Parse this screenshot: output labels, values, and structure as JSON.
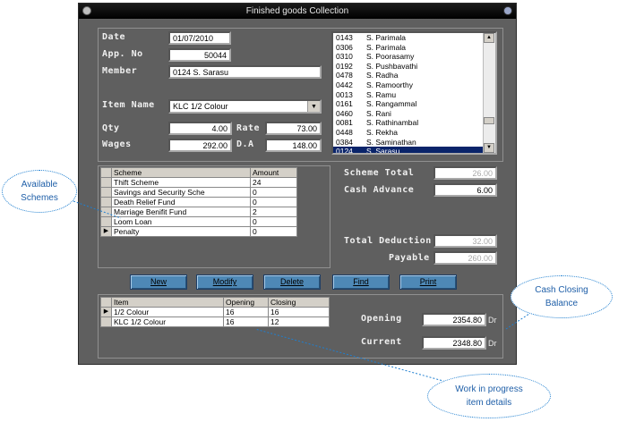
{
  "window": {
    "title": "Finished goods Collection"
  },
  "form": {
    "date_label": "Date",
    "date_value": "01/07/2010",
    "app_no_label": "App. No",
    "app_no_value": "50044",
    "member_label": "Member",
    "member_value": "0124   S. Sarasu",
    "item_name_label": "Item Name",
    "item_name_value": "KLC 1/2 Colour",
    "qty_label": "Qty",
    "qty_value": "4.00",
    "rate_label": "Rate",
    "rate_value": "73.00",
    "wages_label": "Wages",
    "wages_value": "292.00",
    "da_label": "D.A",
    "da_value": "148.00"
  },
  "members": [
    {
      "code": "0143",
      "name": "S. Parimala"
    },
    {
      "code": "0306",
      "name": "S. Parimala"
    },
    {
      "code": "0310",
      "name": "S. Poorasamy"
    },
    {
      "code": "0192",
      "name": "S. Pushbavathi"
    },
    {
      "code": "0478",
      "name": "S. Radha"
    },
    {
      "code": "0442",
      "name": "S. Ramoorthy"
    },
    {
      "code": "0013",
      "name": "S. Ramu"
    },
    {
      "code": "0161",
      "name": "S. Rangammal"
    },
    {
      "code": "0460",
      "name": "S. Rani"
    },
    {
      "code": "0081",
      "name": "S. Rathinambal"
    },
    {
      "code": "0448",
      "name": "S. Rekha"
    },
    {
      "code": "0384",
      "name": "S. Saminathan"
    },
    {
      "code": "0124",
      "name": "S. Sarasu"
    }
  ],
  "schemes": {
    "headers": [
      "Scheme",
      "Amount"
    ],
    "rows": [
      {
        "scheme": "Thift Scheme",
        "amount": "24"
      },
      {
        "scheme": "Savings and Security Sche",
        "amount": "0"
      },
      {
        "scheme": "Death Relief Fund",
        "amount": "0"
      },
      {
        "scheme": "Marriage Benifit Fund",
        "amount": "2"
      },
      {
        "scheme": "Loom Loan",
        "amount": "0"
      },
      {
        "scheme": "Penalty",
        "amount": "0"
      }
    ]
  },
  "totals": {
    "scheme_total_label": "Scheme Total",
    "scheme_total_value": "26.00",
    "cash_advance_label": "Cash Advance",
    "cash_advance_value": "6.00",
    "total_deduction_label": "Total Deduction",
    "total_deduction_value": "32.00",
    "payable_label": "Payable",
    "payable_value": "260.00"
  },
  "buttons": {
    "new": "New",
    "modify": "Modify",
    "delete": "Delete",
    "find": "Find",
    "print": "Print"
  },
  "items": {
    "headers": [
      "Item",
      "Opening",
      "Closing"
    ],
    "rows": [
      {
        "item": "1/2 Colour",
        "opening": "16",
        "closing": "16"
      },
      {
        "item": "KLC 1/2 Colour",
        "opening": "16",
        "closing": "12"
      }
    ]
  },
  "balance": {
    "opening_label": "Opening",
    "opening_value": "2354.80",
    "opening_suffix": "Dr",
    "current_label": "Current",
    "current_value": "2348.80",
    "current_suffix": "Dr"
  },
  "callouts": {
    "schemes": "Available Schemes",
    "cash": "Cash Closing Balance",
    "wip": "Work in progress item details"
  }
}
